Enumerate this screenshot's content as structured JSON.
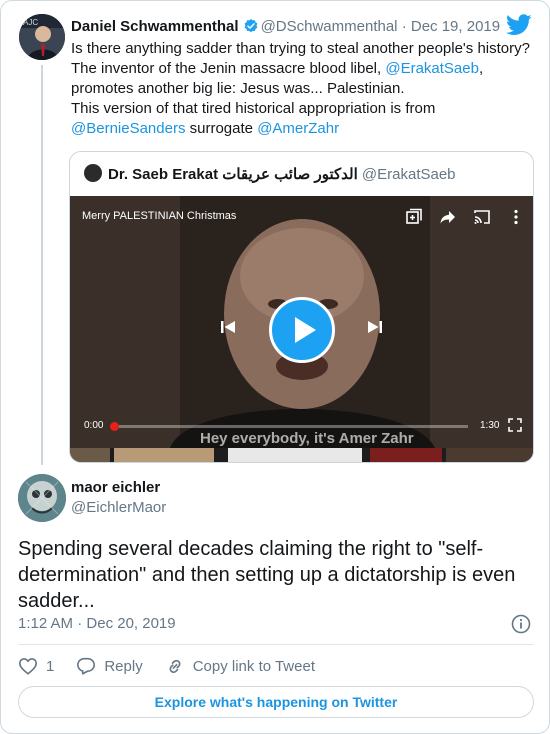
{
  "parent_tweet": {
    "author_name": "Daniel Schwammenthal",
    "handle": "@DSchwammenthal",
    "separator": "·",
    "date": "Dec 19, 2019",
    "text_line1": "Is there anything sadder than trying to steal another people's history?",
    "text_line2_pre": "The inventor of the Jenin massacre blood libel, ",
    "mention1": "@ErakatSaeb",
    "text_line2_post": ",",
    "text_line3": "promotes another big lie: Jesus was... Palestinian.",
    "text_line4": "This version of that tired historical appropriation is from",
    "mention2": "@BernieSanders",
    "text_line5_mid": " surrogate ",
    "mention3": "@AmerZahr"
  },
  "quoted_tweet": {
    "author_name": "Dr. Saeb Erakat الدكتور صائب عريقات",
    "handle": "@ErakatSaeb",
    "video": {
      "title": "Merry PALESTINIAN Christmas",
      "time_current": "0:00",
      "time_total": "1:30",
      "progress": 0,
      "subtitle": "Hey everybody, it's Amer Zahr"
    }
  },
  "reply_tweet": {
    "author_name": "maor eichler",
    "handle": "@EichlerMaor",
    "text": "Spending several decades claiming the right to \"self-determination\" and then setting up a dictatorship is even sadder...",
    "time": "1:12 AM",
    "separator": "·",
    "date": "Dec 20, 2019",
    "like_count": "1",
    "reply_label": "Reply",
    "copy_link_label": "Copy link to Tweet",
    "explore_label": "Explore what's happening on Twitter"
  },
  "icons": {
    "verified": "verified-badge-icon",
    "brand": "twitter-bird-icon",
    "like": "heart-icon",
    "reply": "speech-bubble-icon",
    "copy": "link-icon",
    "info": "info-icon"
  },
  "colors": {
    "link": "#1b95e0",
    "brand": "#1da1f2",
    "muted": "#657786",
    "border": "#cfd9de"
  }
}
